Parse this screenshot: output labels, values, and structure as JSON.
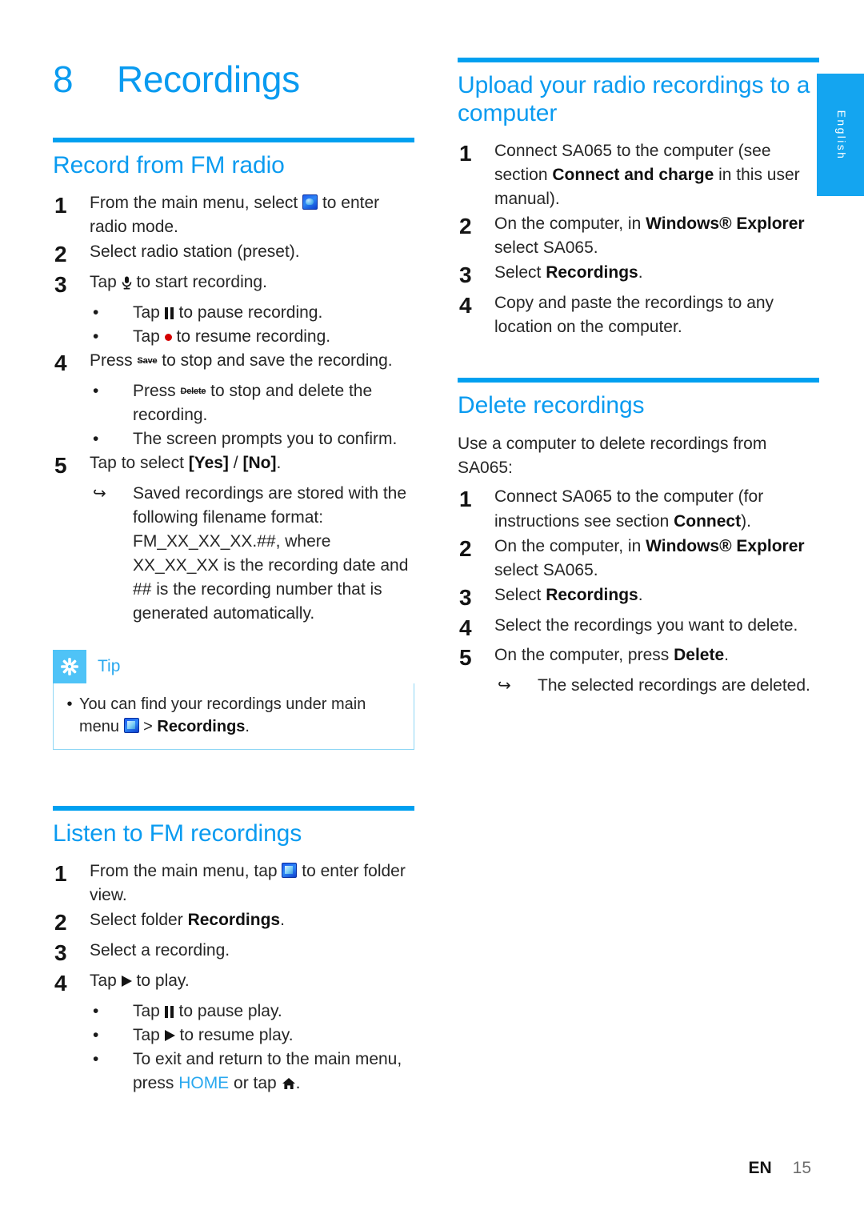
{
  "document": {
    "chapter_number": "8",
    "chapter_title": "Recordings",
    "language_tab": "English",
    "footer": {
      "lang_code": "EN",
      "page_number": "15"
    },
    "accent_color": "#0a9bf0",
    "rule_color": "#00a0f0",
    "tab_color": "#14a5f0"
  },
  "left_column": {
    "section1": {
      "heading": "Record from FM radio",
      "steps": [
        {
          "num": "1",
          "text_before": "From the main menu, select ",
          "icon": "radio-icon",
          "text_after": " to enter radio mode."
        },
        {
          "num": "2",
          "text": "Select radio station (preset)."
        },
        {
          "num": "3",
          "text_before": "Tap ",
          "icon": "microphone-icon",
          "text_after": " to start recording."
        },
        {
          "num": "4",
          "text_before": "Press ",
          "icon": "save-key-icon",
          "key_label": "Save",
          "text_after": " to stop and save the recording."
        },
        {
          "num": "5",
          "text_before": "Tap to select ",
          "bold1": "[Yes]",
          "mid": " / ",
          "bold2": "[No]",
          "text_after": "."
        }
      ],
      "sub_bullets": {
        "pause_before": "Tap ",
        "pause_icon": "pause-icon",
        "pause_after": " to pause recording.",
        "resume_before": "Tap ",
        "resume_icon": "record-dot-icon",
        "resume_after": " to resume recording.",
        "delete_before": "Press ",
        "delete_key_label": "Delete",
        "delete_after": " to stop and delete the recording.",
        "confirm": "The screen prompts you to confirm.",
        "saved_note": "Saved recordings are stored with the following filename format: FM_XX_XX_XX.##, where XX_XX_XX is the recording date and ## is the recording number that is generated automatically."
      }
    },
    "tip": {
      "label": "Tip",
      "icon": "asterisk-icon",
      "text_before": "You can find your recordings under main menu ",
      "icon_inline": "folder-icon",
      "separator": " > ",
      "bold": "Recordings",
      "text_after": "."
    },
    "section2": {
      "heading": "Listen to FM recordings",
      "steps": [
        {
          "num": "1",
          "text_before": "From the main menu, tap ",
          "icon": "folder-icon",
          "text_after": " to enter folder view."
        },
        {
          "num": "2",
          "text_before": "Select folder ",
          "bold": "Recordings",
          "text_after": "."
        },
        {
          "num": "3",
          "text": "Select a recording."
        },
        {
          "num": "4",
          "text_before": "Tap ",
          "icon": "play-icon",
          "text_after": " to play."
        }
      ],
      "sub_bullets": {
        "pause_before": "Tap ",
        "pause_icon": "pause-icon",
        "pause_after": " to pause play.",
        "resume_before": "Tap ",
        "resume_icon": "play-icon",
        "resume_after": " to resume play.",
        "exit_before": "To exit and return to the main menu, press ",
        "exit_key": "HOME",
        "exit_mid": " or tap ",
        "exit_icon": "home-icon",
        "exit_after": "."
      }
    }
  },
  "right_column": {
    "section1": {
      "heading": "Upload your radio recordings to a computer",
      "steps": [
        {
          "num": "1",
          "text_before": "Connect SA065 to the computer (see section ",
          "bold": "Connect and charge",
          "text_after": " in this user manual)."
        },
        {
          "num": "2",
          "text_before": "On the computer, in ",
          "bold": "Windows® Explorer",
          "text_after": " select SA065."
        },
        {
          "num": "3",
          "text_before": "Select ",
          "bold": "Recordings",
          "text_after": "."
        },
        {
          "num": "4",
          "text": "Copy and paste the recordings to any location on the computer."
        }
      ]
    },
    "section2": {
      "heading": "Delete recordings",
      "intro": "Use a computer to delete recordings from SA065:",
      "steps": [
        {
          "num": "1",
          "text_before": "Connect SA065 to the computer (for instructions see section ",
          "bold": "Connect",
          "text_after": ")."
        },
        {
          "num": "2",
          "text_before": "On the computer, in ",
          "bold": "Windows® Explorer",
          "text_after": " select SA065."
        },
        {
          "num": "3",
          "text_before": "Select ",
          "bold": "Recordings",
          "text_after": "."
        },
        {
          "num": "4",
          "text": "Select the recordings you want to delete."
        },
        {
          "num": "5",
          "text_before": "On the computer, press ",
          "bold": "Delete",
          "text_after": "."
        }
      ],
      "result": "The selected recordings are deleted."
    }
  }
}
